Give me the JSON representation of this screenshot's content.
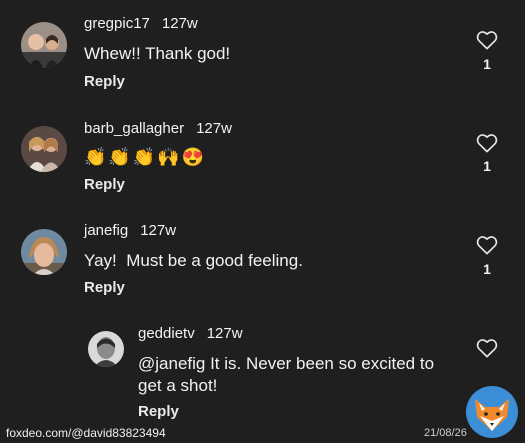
{
  "comments": [
    {
      "username": "gregpic17",
      "age": "127w",
      "text": "Whew!! Thank god!",
      "reply_label": "Reply",
      "likes": "1"
    },
    {
      "username": "barb_gallagher",
      "age": "127w",
      "emojis": [
        "👏",
        "👏",
        "👏",
        "🙌",
        "😍"
      ],
      "reply_label": "Reply",
      "likes": "1"
    },
    {
      "username": "janefig",
      "age": "127w",
      "text": "Yay!  Must be a good feeling.",
      "reply_label": "Reply",
      "likes": "1"
    },
    {
      "username": "geddietv",
      "age": "127w",
      "text_line1": "@janefig It is. Never been so excited to",
      "text_line2": "get a shot!",
      "reply_label": "Reply"
    }
  ],
  "watermark": {
    "site": "foxdeo.com/@david83823494",
    "date": "21/08/26"
  },
  "colors": {
    "background": "#1f1f1f",
    "text": "#f2f2f2"
  },
  "icons": {
    "like": "heart-outline-icon",
    "logo": "fox-logo-icon"
  }
}
